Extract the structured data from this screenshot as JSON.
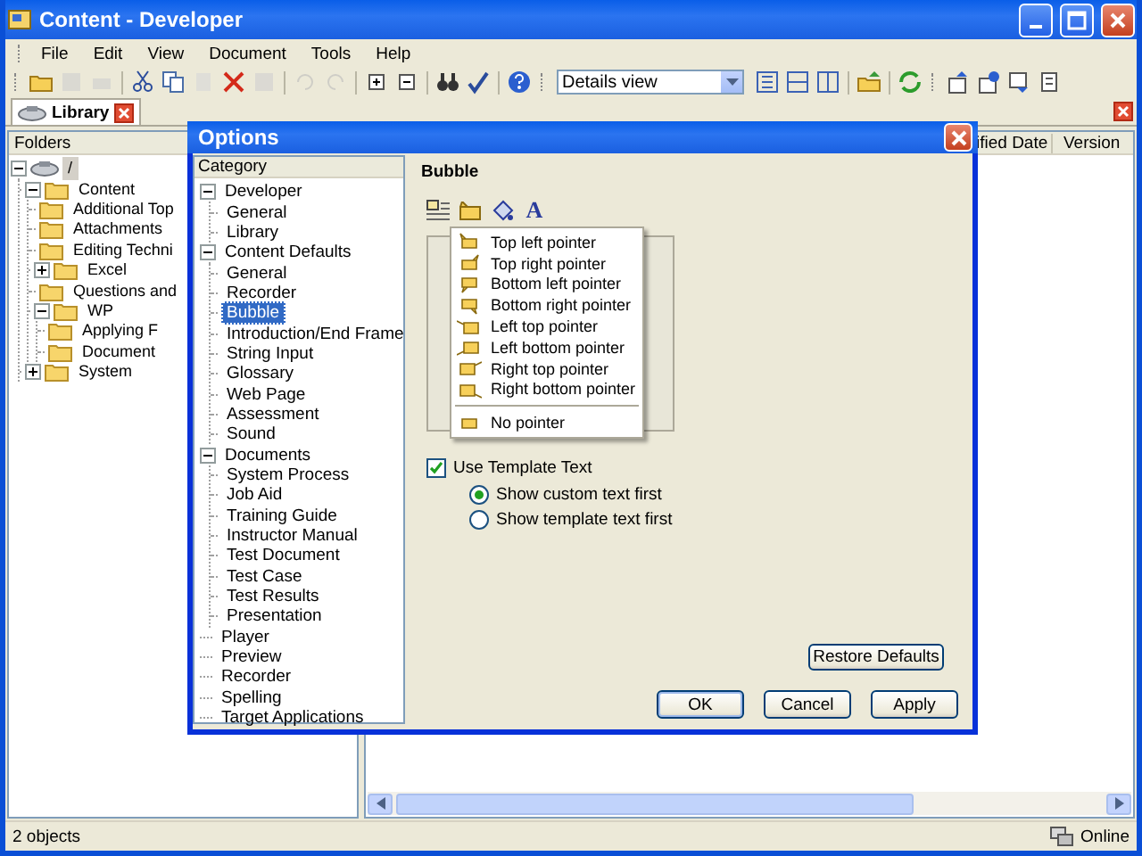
{
  "window": {
    "title": "Content - Developer"
  },
  "menu": [
    "File",
    "Edit",
    "View",
    "Document",
    "Tools",
    "Help"
  ],
  "toolbar": {
    "view_dropdown": "Details view"
  },
  "tabs": [
    {
      "label": "Library",
      "selected": true
    }
  ],
  "folders_pane": {
    "header": "Folders",
    "tree": [
      {
        "label": "/",
        "expanded": true,
        "selected": true,
        "children": [
          {
            "label": "Content",
            "expanded": true,
            "selected": false,
            "children": [
              {
                "label": "Additional Top",
                "selected": false
              },
              {
                "label": "Attachments",
                "selected": false
              },
              {
                "label": "Editing Techni",
                "selected": false
              },
              {
                "label": "Excel",
                "expanded": false,
                "selected": false
              },
              {
                "label": "Questions and",
                "selected": false
              },
              {
                "label": "WP",
                "expanded": true,
                "selected": false,
                "children": [
                  {
                    "label": "Applying F",
                    "selected": false
                  },
                  {
                    "label": "Document",
                    "selected": false
                  }
                ]
              }
            ]
          },
          {
            "label": "System",
            "expanded": false,
            "selected": false
          }
        ]
      }
    ]
  },
  "list_pane": {
    "columns": [
      "ified Date",
      "Version"
    ]
  },
  "status_bar": {
    "text": "2 objects",
    "connection": "Online"
  },
  "dialog": {
    "title": "Options",
    "category_header": "Category",
    "categories": [
      {
        "label": "Developer",
        "expanded": true,
        "selected": false,
        "children": [
          {
            "label": "General",
            "selected": false
          },
          {
            "label": "Library",
            "selected": false
          }
        ]
      },
      {
        "label": "Content Defaults",
        "expanded": true,
        "selected": false,
        "children": [
          {
            "label": "General",
            "selected": false
          },
          {
            "label": "Recorder",
            "selected": false
          },
          {
            "label": "Bubble",
            "selected": true
          },
          {
            "label": "Introduction/End Frame",
            "selected": false
          },
          {
            "label": "String Input",
            "selected": false
          },
          {
            "label": "Glossary",
            "selected": false
          },
          {
            "label": "Web Page",
            "selected": false
          },
          {
            "label": "Assessment",
            "selected": false
          },
          {
            "label": "Sound",
            "selected": false
          }
        ]
      },
      {
        "label": "Documents",
        "expanded": true,
        "selected": false,
        "children": [
          {
            "label": "System Process",
            "selected": false
          },
          {
            "label": "Job Aid",
            "selected": false
          },
          {
            "label": "Training Guide",
            "selected": false
          },
          {
            "label": "Instructor Manual",
            "selected": false
          },
          {
            "label": "Test Document",
            "selected": false
          },
          {
            "label": "Test Case",
            "selected": false
          },
          {
            "label": "Test Results",
            "selected": false
          },
          {
            "label": "Presentation",
            "selected": false
          }
        ]
      },
      {
        "label": "Player",
        "selected": false
      },
      {
        "label": "Preview",
        "selected": false
      },
      {
        "label": "Recorder",
        "selected": false
      },
      {
        "label": "Spelling",
        "selected": false
      },
      {
        "label": "Target Applications",
        "selected": false
      }
    ],
    "page_title": "Bubble",
    "font_button": "A",
    "pointer_menu": {
      "items": [
        "Top left pointer",
        "Top right pointer",
        "Bottom left pointer",
        "Bottom right pointer",
        "Left top pointer",
        "Left bottom pointer",
        "Right top pointer",
        "Right bottom pointer"
      ],
      "extra": [
        "No pointer"
      ]
    },
    "use_template": {
      "label": "Use Template Text",
      "checked": true
    },
    "radios": [
      {
        "label": "Show custom text first",
        "selected": true
      },
      {
        "label": "Show template text first",
        "selected": false
      }
    ],
    "restore_button": "Restore Defaults",
    "buttons": [
      "OK",
      "Cancel",
      "Apply"
    ]
  }
}
